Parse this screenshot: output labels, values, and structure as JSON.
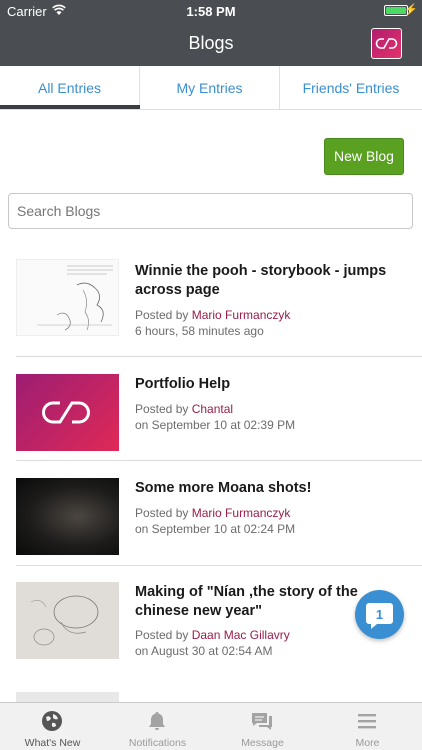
{
  "status_bar": {
    "carrier": "Carrier",
    "time": "1:58 PM"
  },
  "nav": {
    "title": "Blogs"
  },
  "tabs": [
    {
      "label": "All Entries",
      "active": true
    },
    {
      "label": "My Entries",
      "active": false
    },
    {
      "label": "Friends' Entries",
      "active": false
    }
  ],
  "actions": {
    "new_blog_label": "New Blog"
  },
  "search": {
    "placeholder": "Search Blogs"
  },
  "entries": [
    {
      "title": "Winnie the pooh - storybook - jumps across page",
      "posted_by_prefix": "Posted by",
      "author": "Mario Furmanczyk",
      "when": "6 hours, 58 minutes ago",
      "thumb": "sketch"
    },
    {
      "title": "Portfolio Help",
      "posted_by_prefix": "Posted by",
      "author": "Chantal",
      "when": "on September 10 at 02:39 PM",
      "thumb": "logo"
    },
    {
      "title": "Some more Moana shots!",
      "posted_by_prefix": "Posted by",
      "author": "Mario Furmanczyk",
      "when": "on September 10 at 02:24 PM",
      "thumb": "dark"
    },
    {
      "title": "Making of \"Nían ,the story of the chinese new year\"",
      "posted_by_prefix": "Posted by",
      "author": "Daan Mac Gillavry",
      "when": "on August 30 at 02:54 AM",
      "thumb": "pencil"
    }
  ],
  "chat": {
    "badge": "1"
  },
  "bottom_bar": [
    {
      "label": "What's New",
      "icon": "globe-icon",
      "active": true
    },
    {
      "label": "Notifications",
      "icon": "bell-icon",
      "active": false
    },
    {
      "label": "Message",
      "icon": "chat-icon",
      "active": false
    },
    {
      "label": "More",
      "icon": "menu-icon",
      "active": false
    }
  ],
  "colors": {
    "nav_bg": "#4a4d52",
    "tab_text": "#3a8fd2",
    "new_blog_bg": "#5aa021",
    "author": "#9a1d4a",
    "chat_bubble": "#3a8fd2"
  }
}
